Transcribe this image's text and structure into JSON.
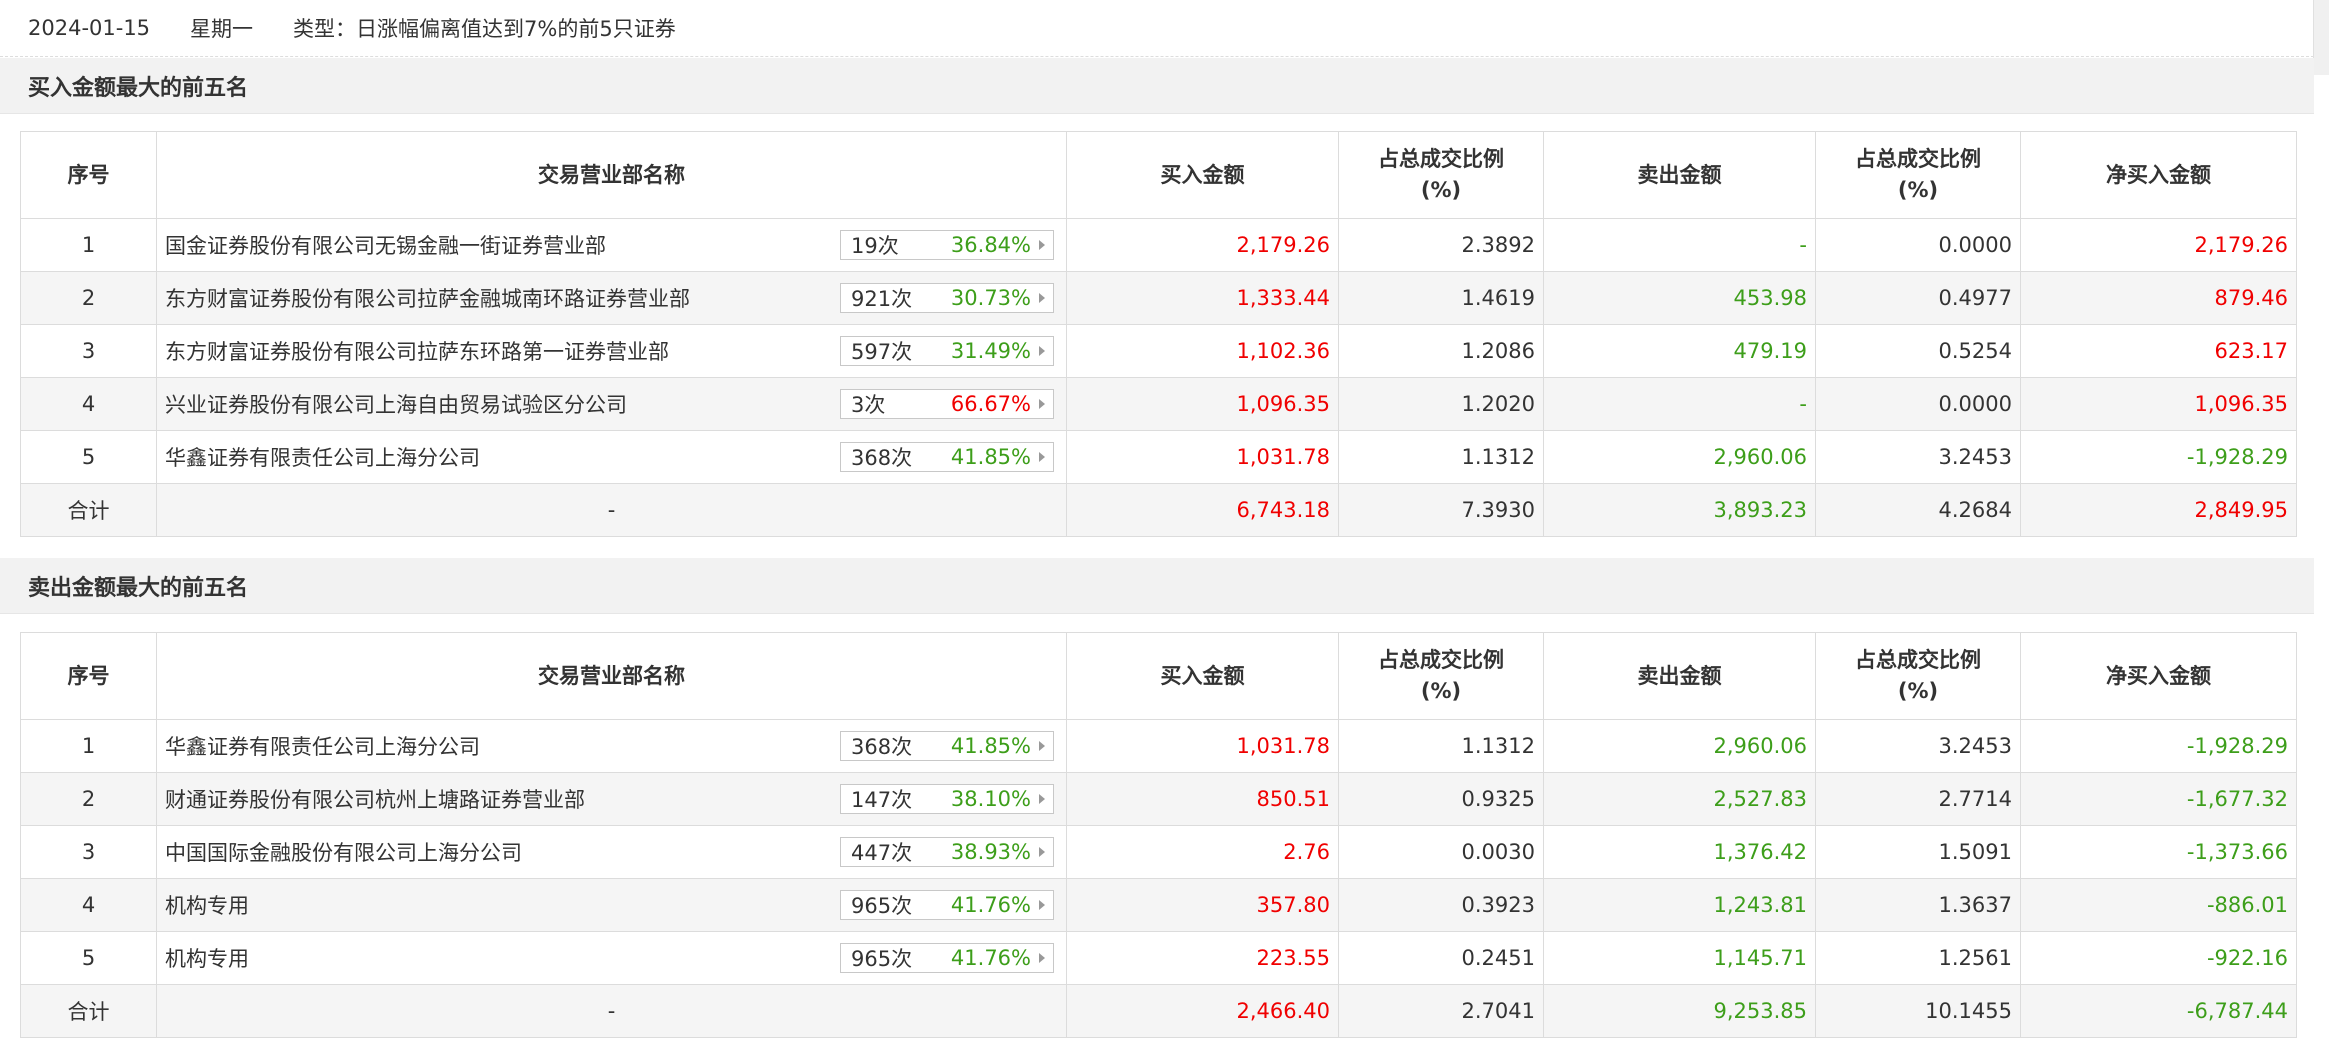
{
  "header": {
    "date": "2024-01-15",
    "weekday": "星期一",
    "type_text": "类型：日涨幅偏离值达到7%的前5只证券"
  },
  "columns": {
    "idx": "序号",
    "name": "交易营业部名称",
    "buy": "买入金额",
    "buy_ratio": "占总成交比例\n(%)",
    "sell": "卖出金额",
    "sell_ratio": "占总成交比例\n(%)",
    "net": "净买入金额"
  },
  "buy_section": {
    "title": "买入金额最大的前五名",
    "rows": [
      {
        "idx": "1",
        "name": "国金证券股份有限公司无锡金融一街证券营业部",
        "count": "19次",
        "rate": "36.84%",
        "buy": "2,179.26",
        "buy_ratio": "2.3892",
        "sell": "-",
        "sell_ratio": "0.0000",
        "net": "2,179.26"
      },
      {
        "idx": "2",
        "name": "东方财富证券股份有限公司拉萨金融城南环路证券营业部",
        "count": "921次",
        "rate": "30.73%",
        "buy": "1,333.44",
        "buy_ratio": "1.4619",
        "sell": "453.98",
        "sell_ratio": "0.4977",
        "net": "879.46"
      },
      {
        "idx": "3",
        "name": "东方财富证券股份有限公司拉萨东环路第一证券营业部",
        "count": "597次",
        "rate": "31.49%",
        "buy": "1,102.36",
        "buy_ratio": "1.2086",
        "sell": "479.19",
        "sell_ratio": "0.5254",
        "net": "623.17"
      },
      {
        "idx": "4",
        "name": "兴业证券股份有限公司上海自由贸易试验区分公司",
        "count": "3次",
        "rate": "66.67%",
        "buy": "1,096.35",
        "buy_ratio": "1.2020",
        "sell": "-",
        "sell_ratio": "0.0000",
        "net": "1,096.35"
      },
      {
        "idx": "5",
        "name": "华鑫证券有限责任公司上海分公司",
        "count": "368次",
        "rate": "41.85%",
        "buy": "1,031.78",
        "buy_ratio": "1.1312",
        "sell": "2,960.06",
        "sell_ratio": "3.2453",
        "net": "-1,928.29"
      }
    ],
    "total": {
      "label": "合计",
      "name": "-",
      "buy": "6,743.18",
      "buy_ratio": "7.3930",
      "sell": "3,893.23",
      "sell_ratio": "4.2684",
      "net": "2,849.95"
    }
  },
  "sell_section": {
    "title": "卖出金额最大的前五名",
    "rows": [
      {
        "idx": "1",
        "name": "华鑫证券有限责任公司上海分公司",
        "count": "368次",
        "rate": "41.85%",
        "buy": "1,031.78",
        "buy_ratio": "1.1312",
        "sell": "2,960.06",
        "sell_ratio": "3.2453",
        "net": "-1,928.29"
      },
      {
        "idx": "2",
        "name": "财通证券股份有限公司杭州上塘路证券营业部",
        "count": "147次",
        "rate": "38.10%",
        "buy": "850.51",
        "buy_ratio": "0.9325",
        "sell": "2,527.83",
        "sell_ratio": "2.7714",
        "net": "-1,677.32"
      },
      {
        "idx": "3",
        "name": "中国国际金融股份有限公司上海分公司",
        "count": "447次",
        "rate": "38.93%",
        "buy": "2.76",
        "buy_ratio": "0.0030",
        "sell": "1,376.42",
        "sell_ratio": "1.5091",
        "net": "-1,373.66"
      },
      {
        "idx": "4",
        "name": "机构专用",
        "count": "965次",
        "rate": "41.76%",
        "buy": "357.80",
        "buy_ratio": "0.3923",
        "sell": "1,243.81",
        "sell_ratio": "1.3637",
        "net": "-886.01"
      },
      {
        "idx": "5",
        "name": "机构专用",
        "count": "965次",
        "rate": "41.76%",
        "buy": "223.55",
        "buy_ratio": "0.2451",
        "sell": "1,145.71",
        "sell_ratio": "1.2561",
        "net": "-922.16"
      }
    ],
    "total": {
      "label": "合计",
      "name": "-",
      "buy": "2,466.40",
      "buy_ratio": "2.7041",
      "sell": "9,253.85",
      "sell_ratio": "10.1455",
      "net": "-6,787.44"
    }
  },
  "colors": {
    "positive": "#f00000",
    "negative": "#3d9e1a",
    "header_bg": "#f2f2f2",
    "stripe": "#f5f5f5"
  }
}
